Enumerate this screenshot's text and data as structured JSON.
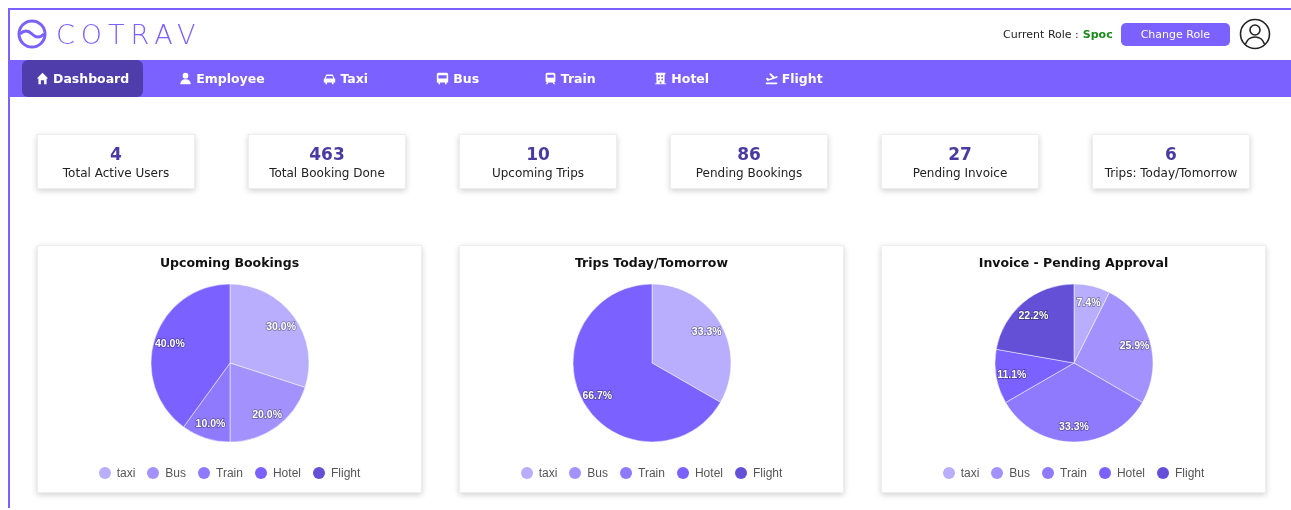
{
  "header": {
    "logo": "COTRAV",
    "role_label": "Current Role :",
    "role_value": "Spoc",
    "change_role_button": "Change Role"
  },
  "nav": [
    {
      "label": "Dashboard",
      "kind": "home",
      "selected": true
    },
    {
      "label": "Employee",
      "kind": "person",
      "selected": false
    },
    {
      "label": "Taxi",
      "kind": "taxi",
      "selected": false
    },
    {
      "label": "Bus",
      "kind": "bus",
      "selected": false
    },
    {
      "label": "Train",
      "kind": "train",
      "selected": false
    },
    {
      "label": "Hotel",
      "kind": "hotel",
      "selected": false
    },
    {
      "label": "Flight",
      "kind": "flight",
      "selected": false
    }
  ],
  "stats": [
    {
      "value": "4",
      "label": "Total Active Users"
    },
    {
      "value": "463",
      "label": "Total Booking Done"
    },
    {
      "value": "10",
      "label": "Upcoming Trips"
    },
    {
      "value": "86",
      "label": "Pending Bookings"
    },
    {
      "value": "27",
      "label": "Pending Invoice"
    },
    {
      "value": "6",
      "label": "Trips: Today/Tomorrow"
    }
  ],
  "charts": [
    {
      "chart_data": {
        "type": "pie",
        "title": "Upcoming Bookings",
        "categories": [
          "taxi",
          "Bus",
          "Train",
          "Hotel",
          "Flight"
        ],
        "colors": [
          "#b9aefe",
          "#a391fd",
          "#8f79fd",
          "#7b61ff",
          "#6350d6"
        ],
        "series": [
          {
            "values": [
              30.0,
              20.0,
              10.0,
              40.0,
              0
            ]
          }
        ],
        "value_labels": [
          "30.0%",
          "20.0%",
          "10.0%",
          "40.0%",
          null
        ]
      }
    },
    {
      "chart_data": {
        "type": "pie",
        "title": "Trips Today/Tomorrow",
        "categories": [
          "taxi",
          "Bus",
          "Train",
          "Hotel",
          "Flight"
        ],
        "colors": [
          "#b9aefe",
          "#a391fd",
          "#8f79fd",
          "#7b61ff",
          "#6350d6"
        ],
        "series": [
          {
            "values": [
              33.3,
              0,
              0,
              66.7,
              0
            ]
          }
        ],
        "value_labels": [
          "33.3%",
          null,
          null,
          "66.7%",
          null
        ]
      }
    },
    {
      "chart_data": {
        "type": "pie",
        "title": "Invoice - Pending Approval",
        "categories": [
          "taxi",
          "Bus",
          "Train",
          "Hotel",
          "Flight"
        ],
        "colors": [
          "#b9aefe",
          "#a391fd",
          "#8f79fd",
          "#7b61ff",
          "#6350d6"
        ],
        "series": [
          {
            "values": [
              7.4,
              25.9,
              33.3,
              11.1,
              22.2
            ]
          }
        ],
        "value_labels": [
          "7.4%",
          "25.9%",
          "33.3%",
          "11.1%",
          "22.2%"
        ]
      }
    }
  ]
}
